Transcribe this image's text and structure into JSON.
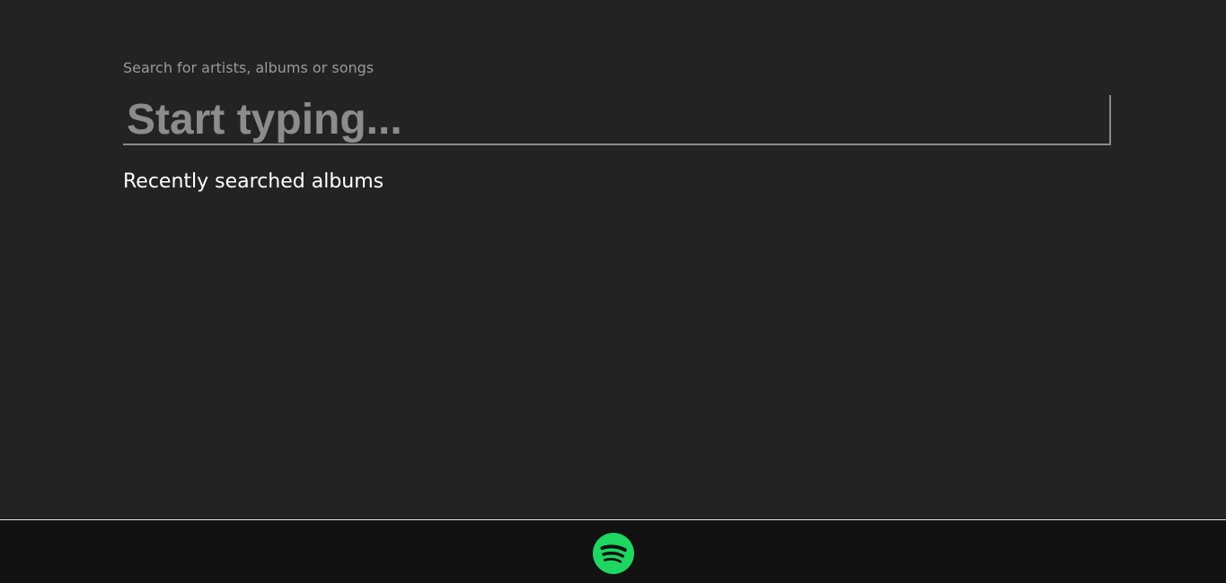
{
  "search": {
    "label": "Search for artists, albums or songs",
    "placeholder": "Start typing...",
    "value": ""
  },
  "recent": {
    "title": "Recently searched albums",
    "albums": []
  },
  "footer": {
    "logo_icon": "spotify-logo-icon",
    "logo_color": "#1ed760"
  },
  "colors": {
    "background": "#232323",
    "footer_background": "#121212",
    "accent": "#1ed760"
  }
}
